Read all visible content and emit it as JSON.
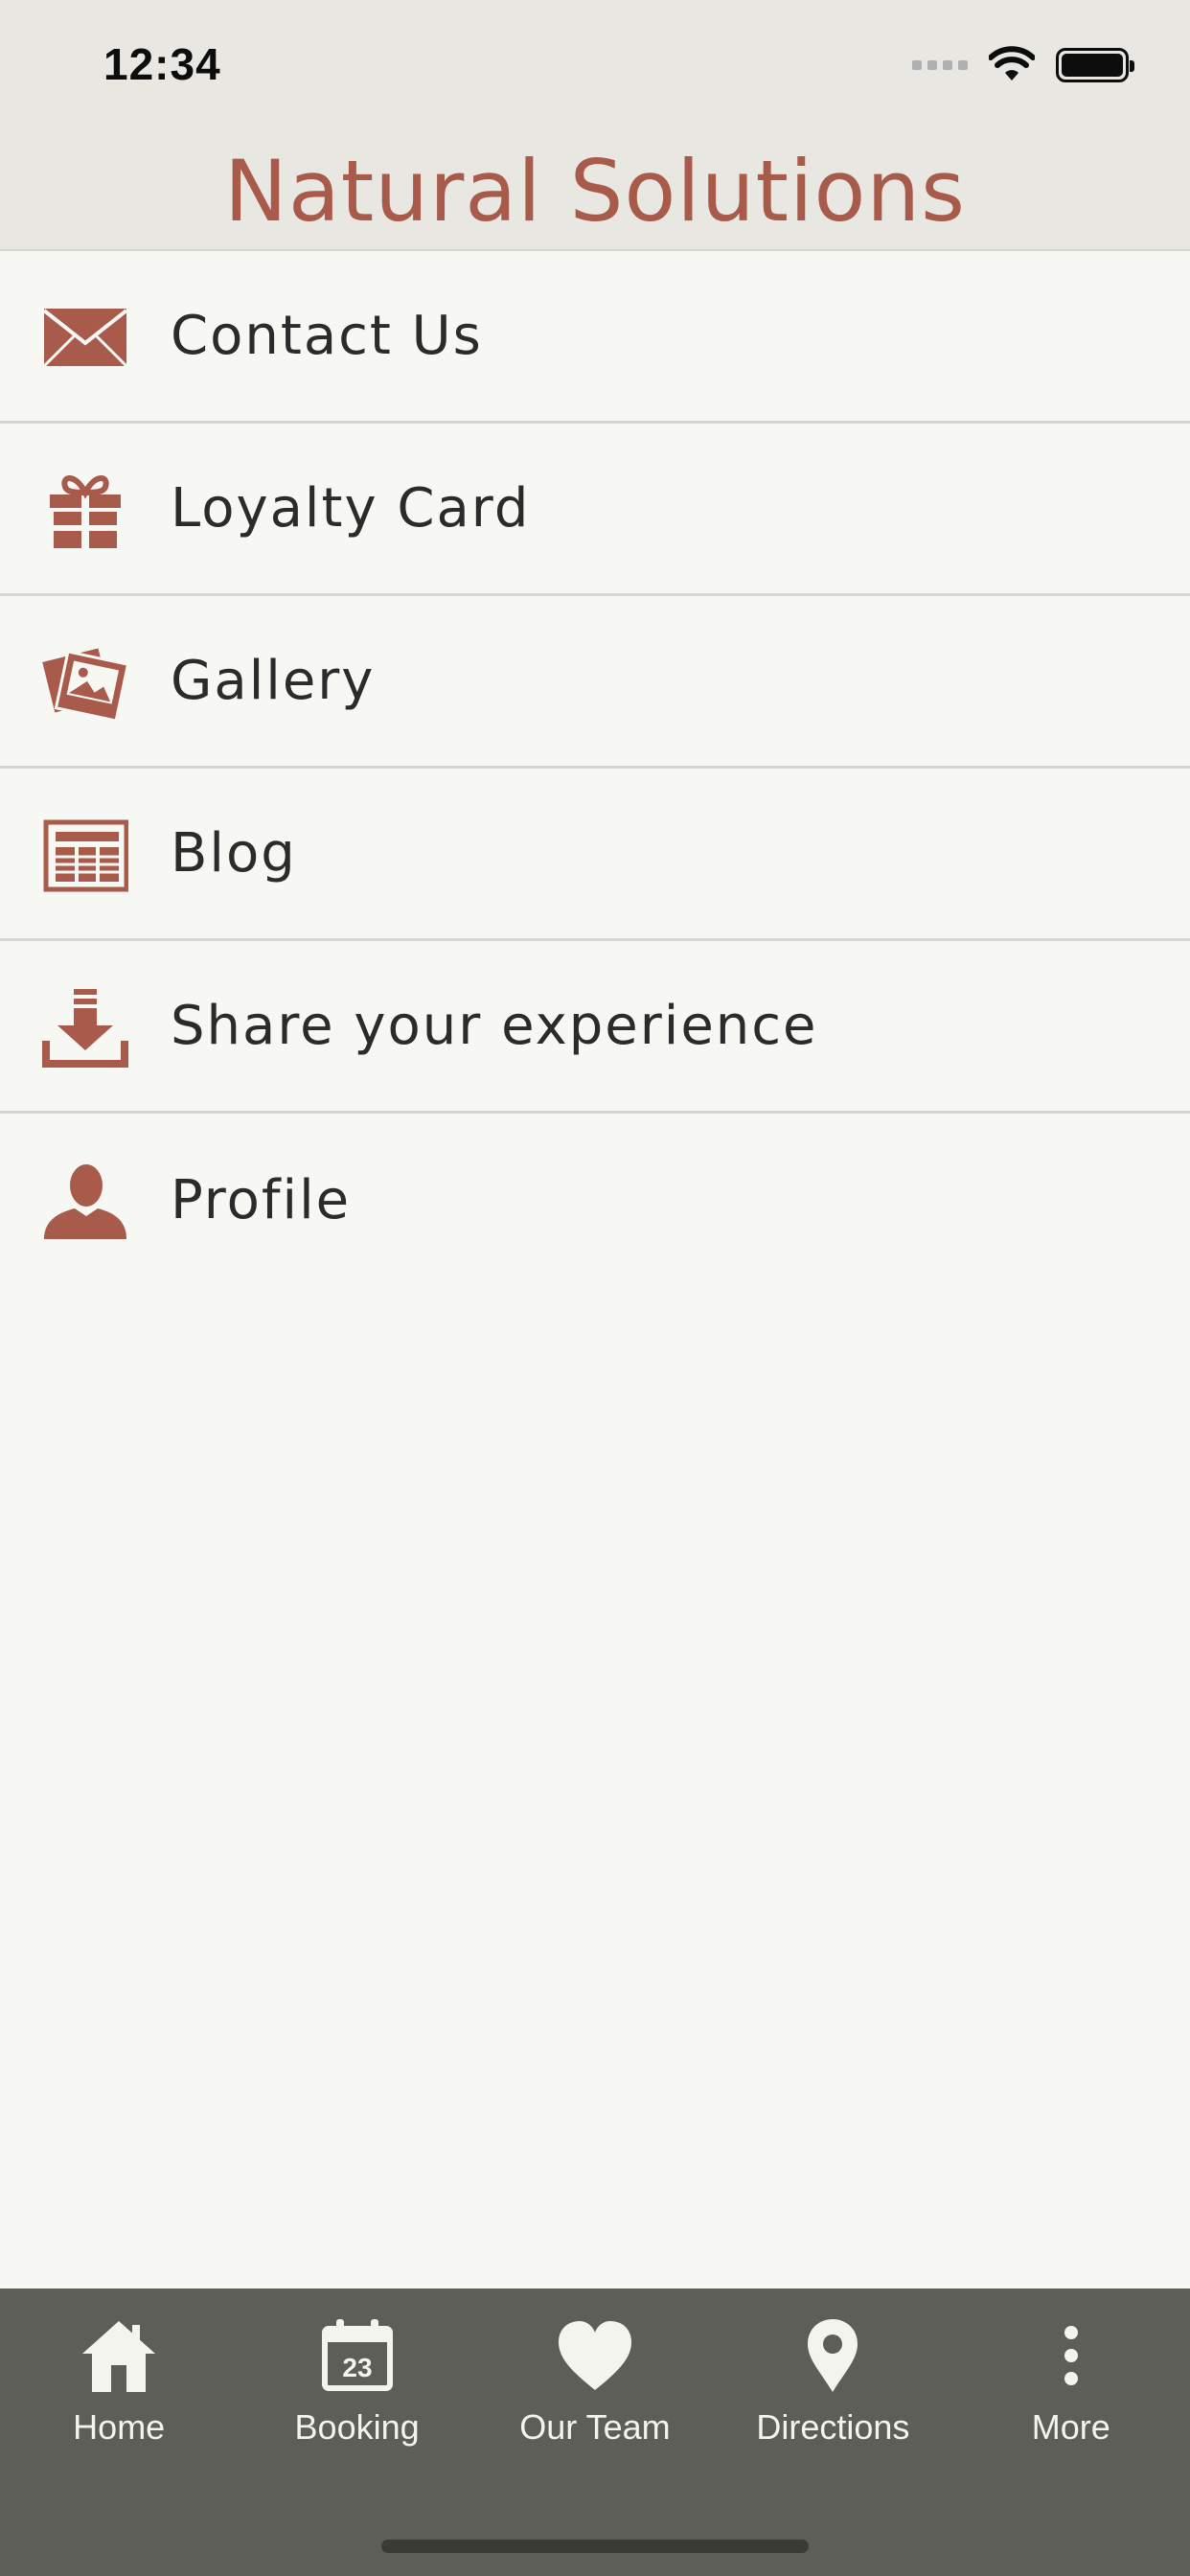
{
  "status": {
    "time": "12:34"
  },
  "app": {
    "title": "Natural Solutions"
  },
  "colors": {
    "accent": "#a85a4b",
    "header_bg": "#e8e7e1",
    "tabbar_bg": "#5e5e58"
  },
  "menu": {
    "items": [
      {
        "label": "Contact Us",
        "icon": "envelope-icon"
      },
      {
        "label": "Loyalty Card",
        "icon": "gift-icon"
      },
      {
        "label": "Gallery",
        "icon": "photos-icon"
      },
      {
        "label": "Blog",
        "icon": "newspaper-icon"
      },
      {
        "label": "Share your experience",
        "icon": "download-tray-icon"
      },
      {
        "label": "Profile",
        "icon": "person-icon"
      }
    ]
  },
  "tabbar": {
    "tabs": [
      {
        "label": "Home",
        "icon": "home-icon"
      },
      {
        "label": "Booking",
        "icon": "calendar-icon",
        "badge": "23"
      },
      {
        "label": "Our Team",
        "icon": "heart-icon"
      },
      {
        "label": "Directions",
        "icon": "location-pin-icon"
      },
      {
        "label": "More",
        "icon": "more-vertical-icon"
      }
    ]
  }
}
